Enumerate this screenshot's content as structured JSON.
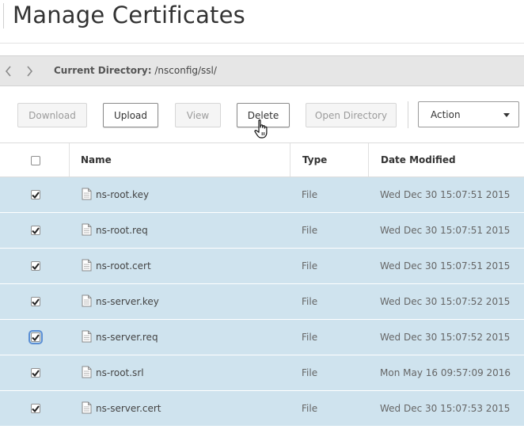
{
  "page": {
    "title": "Manage Certificates"
  },
  "directory": {
    "label": "Current Directory:",
    "path": "/nsconfig/ssl/"
  },
  "toolbar": {
    "download_label": "Download",
    "upload_label": "Upload",
    "view_label": "View",
    "delete_label": "Delete",
    "open_directory_label": "Open Directory",
    "action_label": "Action"
  },
  "table": {
    "columns": {
      "name": "Name",
      "type": "Type",
      "date": "Date Modified"
    },
    "rows": [
      {
        "name": "ns-root.key",
        "type": "File",
        "date": "Wed Dec 30 15:07:51 2015",
        "checked": true
      },
      {
        "name": "ns-root.req",
        "type": "File",
        "date": "Wed Dec 30 15:07:51 2015",
        "checked": true
      },
      {
        "name": "ns-root.cert",
        "type": "File",
        "date": "Wed Dec 30 15:07:51 2015",
        "checked": true
      },
      {
        "name": "ns-server.key",
        "type": "File",
        "date": "Wed Dec 30 15:07:52 2015",
        "checked": true
      },
      {
        "name": "ns-server.req",
        "type": "File",
        "date": "Wed Dec 30 15:07:52 2015",
        "checked": true
      },
      {
        "name": "ns-root.srl",
        "type": "File",
        "date": "Mon May 16 09:57:09 2016",
        "checked": true
      },
      {
        "name": "ns-server.cert",
        "type": "File",
        "date": "Wed Dec 30 15:07:53 2015",
        "checked": true
      }
    ]
  },
  "colors": {
    "selected_row": "#cfe3ee",
    "directory_bar": "#e6e6e6"
  }
}
